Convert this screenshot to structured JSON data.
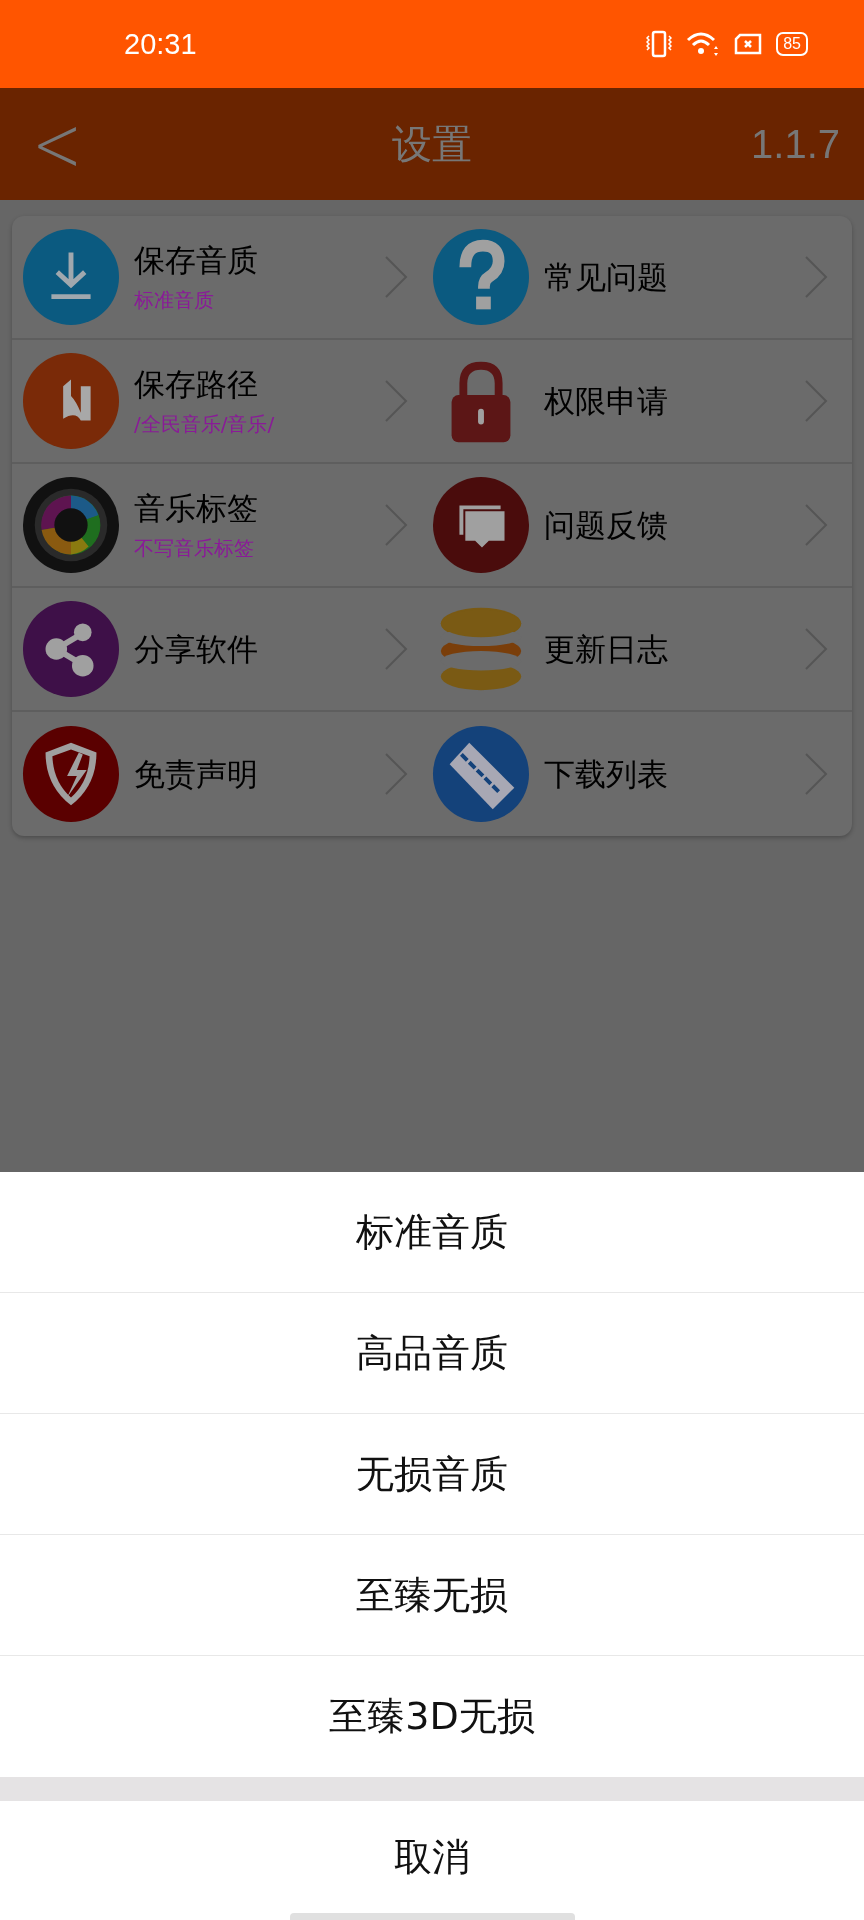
{
  "status_bar": {
    "time": "20:31",
    "battery": "85"
  },
  "header": {
    "back": "<",
    "title": "设置",
    "version": "1.1.7"
  },
  "settings": [
    {
      "title": "保存音质",
      "subtitle": "标准音质"
    },
    {
      "title": "常见问题"
    },
    {
      "title": "保存路径",
      "subtitle": "/全民音乐/音乐/"
    },
    {
      "title": "权限申请"
    },
    {
      "title": "音乐标签",
      "subtitle": "不写音乐标签"
    },
    {
      "title": "问题反馈"
    },
    {
      "title": "分享软件"
    },
    {
      "title": "更新日志"
    },
    {
      "title": "免责声明"
    },
    {
      "title": "下载列表"
    }
  ],
  "sheet": {
    "options": [
      "标准音质",
      "高品音质",
      "无损音质",
      "至臻无损",
      "至臻3D无损"
    ],
    "cancel": "取消"
  }
}
